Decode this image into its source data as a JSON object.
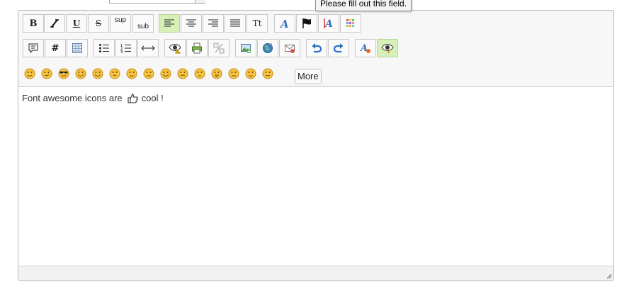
{
  "tooltip": "Please fill out this field.",
  "toolbar": {
    "row1": [
      {
        "name": "bold-button",
        "label": "B"
      },
      {
        "name": "italic-button",
        "label": "I"
      },
      {
        "name": "underline-button",
        "label": "U"
      },
      {
        "name": "strikethrough-button",
        "label": "S"
      },
      {
        "name": "superscript-button",
        "label": "sup"
      },
      {
        "name": "subscript-button",
        "label": "sub"
      },
      {
        "name": "align-left-button",
        "active": true
      },
      {
        "name": "align-center-button"
      },
      {
        "name": "align-right-button"
      },
      {
        "name": "justify-button"
      },
      {
        "name": "font-size-button",
        "label": "Tt"
      },
      {
        "name": "font-button"
      },
      {
        "name": "flag-button"
      },
      {
        "name": "text-color-button"
      },
      {
        "name": "color-palette-button"
      }
    ],
    "row2": [
      "quote-button",
      "hash-button",
      "table-button",
      "bullet-list-button",
      "numbered-list-button",
      "horizontal-rule-button",
      "preview-button",
      "print-button",
      "remove-format-button",
      "image-button",
      "link-button",
      "email-button",
      "undo-button",
      "redo-button",
      "spellcheck-button",
      "toggle-view-button"
    ],
    "smileys_count": 15,
    "more_label": "More"
  },
  "content": {
    "text_before": "Font awesome icons are",
    "text_after": "cool !"
  },
  "colors": {
    "active_button": "#d6f0b8",
    "smiley_fill": "#f6c343",
    "smiley_outline": "#c88a12"
  }
}
